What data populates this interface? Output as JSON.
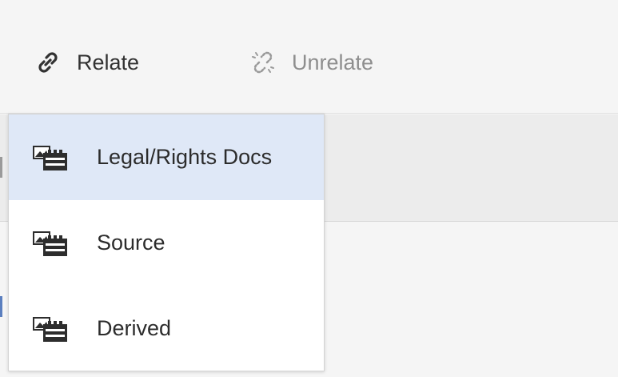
{
  "toolbar": {
    "relate": {
      "label": "Relate",
      "icon": "link-icon"
    },
    "unrelate": {
      "label": "Unrelate",
      "icon": "broken-link-icon"
    }
  },
  "menu": {
    "items": [
      {
        "label": "Legal/Rights Docs",
        "icon": "asset-collection-icon",
        "active": true
      },
      {
        "label": "Source",
        "icon": "asset-collection-icon",
        "active": false
      },
      {
        "label": "Derived",
        "icon": "asset-collection-icon",
        "active": false
      }
    ]
  },
  "colors": {
    "accent_highlight": "#dfe8f7",
    "disabled_text": "#8e8e8e",
    "text": "#323232"
  }
}
